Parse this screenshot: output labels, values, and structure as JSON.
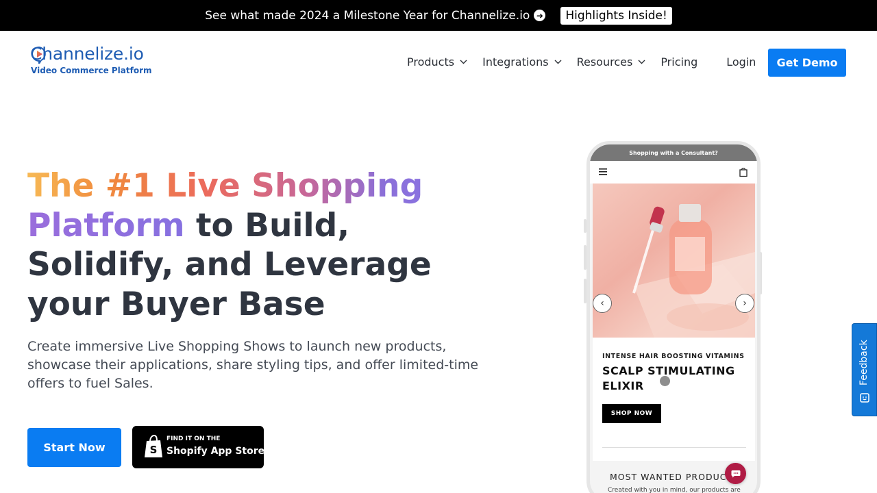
{
  "announcement": {
    "text": "See what made 2024 a Milestone Year for Channelize.io",
    "button_label": "Highlights Inside!"
  },
  "header": {
    "logo_text": "Channelize.io",
    "logo_tagline": "Video Commerce Platform",
    "nav": [
      {
        "label": "Products",
        "has_dropdown": true
      },
      {
        "label": "Integrations",
        "has_dropdown": true
      },
      {
        "label": "Resources",
        "has_dropdown": true
      },
      {
        "label": "Pricing",
        "has_dropdown": false
      }
    ],
    "login_label": "Login",
    "cta_label": "Get Demo"
  },
  "hero": {
    "headline_gradient_1": "The #1 Live Shopping",
    "headline_gradient_2": "Platform",
    "headline_rest": " to Build, Solidify, and Leverage your Buyer Base",
    "subtext": "Create immersive Live Shopping Shows to launch new products, showcase their applications, share styling tips, and offer limited-time offers to fuel Sales.",
    "start_label": "Start Now",
    "shopify_small": "FIND IT ON THE",
    "shopify_big": "Shopify App Store"
  },
  "phone": {
    "top_banner": "Shopping with a Consultant?",
    "product_kicker": "INTENSE HAIR BOOSTING VITAMINS",
    "product_title": "SCALP STIMULATING ELIXIR",
    "shop_label": "SHOP NOW",
    "section_title": "MOST WANTED PRODUCTS",
    "section_sub": "Created with you in mind, our products are"
  },
  "feedback": {
    "label": "Feedback"
  },
  "colors": {
    "accent_blue": "#0a7cf2",
    "brand_blue": "#1e5cb3",
    "chat_red": "#b01c45"
  }
}
